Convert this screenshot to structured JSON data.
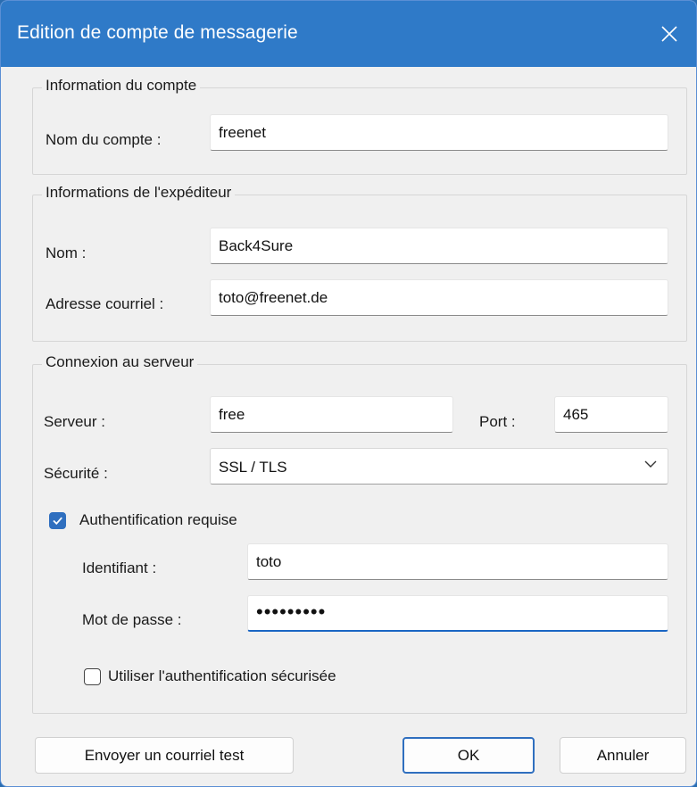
{
  "window": {
    "title": "Edition de compte de messagerie"
  },
  "account": {
    "legend": "Information du compte",
    "name_label": "Nom du compte :",
    "name_value": "freenet"
  },
  "sender": {
    "legend": "Informations de l'expéditeur",
    "name_label": "Nom :",
    "name_value": "Back4Sure",
    "email_label": "Adresse courriel :",
    "email_value": "toto@freenet.de"
  },
  "server": {
    "legend": "Connexion au serveur",
    "server_label": "Serveur :",
    "server_value": "free",
    "port_label": "Port :",
    "port_value": "465",
    "security_label": "Sécurité :",
    "security_value": "SSL / TLS",
    "auth_checkbox_label": "Authentification requise",
    "auth_checked": true,
    "login_label": "Identifiant :",
    "login_value": "toto",
    "password_label": "Mot de passe :",
    "password_value": "•••••••••",
    "secure_auth_label": "Utiliser l'authentification sécurisée",
    "secure_auth_checked": false
  },
  "buttons": {
    "send_test": "Envoyer un courriel test",
    "ok": "OK",
    "cancel": "Annuler"
  },
  "colors": {
    "titlebar": "#2f7ac8",
    "accent": "#2f6fbf",
    "dialog_bg": "#f0f0f0"
  }
}
